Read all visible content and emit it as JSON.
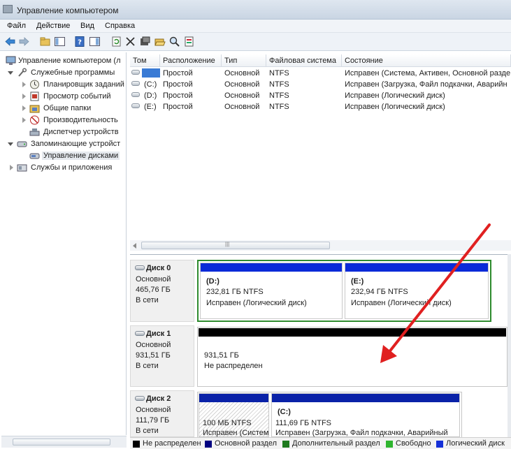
{
  "window": {
    "title": "Управление компьютером"
  },
  "menu": [
    "Файл",
    "Действие",
    "Вид",
    "Справка"
  ],
  "toolbar": {
    "icons": [
      "back-icon",
      "forward-icon",
      "up-folder-icon",
      "console-tree-icon",
      "help-icon",
      "show-hide-icon",
      "refresh-icon",
      "delete-icon",
      "properties-icon",
      "open-icon",
      "search-icon",
      "export-icon"
    ]
  },
  "tree": {
    "items": [
      {
        "label": "Управление компьютером (л",
        "icon": "computer-icon"
      },
      {
        "label": "Служебные программы",
        "icon": "tools-icon"
      },
      {
        "label": "Планировщик заданий",
        "icon": "clock-icon"
      },
      {
        "label": "Просмотр событий",
        "icon": "event-viewer-icon"
      },
      {
        "label": "Общие папки",
        "icon": "shared-folder-icon"
      },
      {
        "label": "Производительность",
        "icon": "performance-icon"
      },
      {
        "label": "Диспетчер устройств",
        "icon": "device-manager-icon"
      },
      {
        "label": "Запоминающие устройст",
        "icon": "storage-icon"
      },
      {
        "label": "Управление дисками",
        "icon": "disk-management-icon"
      },
      {
        "label": "Службы и приложения",
        "icon": "services-icon"
      }
    ]
  },
  "volumes": {
    "columns": [
      "Том",
      "Расположение",
      "Тип",
      "Файловая система",
      "Состояние"
    ],
    "rows": [
      {
        "volume": "",
        "layout": "Простой",
        "type": "Основной",
        "fs": "NTFS",
        "status": "Исправен (Система, Активен, Основной разде"
      },
      {
        "volume": "(C:)",
        "layout": "Простой",
        "type": "Основной",
        "fs": "NTFS",
        "status": "Исправен (Загрузка, Файл подкачки, Аварийн"
      },
      {
        "volume": "(D:)",
        "layout": "Простой",
        "type": "Основной",
        "fs": "NTFS",
        "status": "Исправен (Логический диск)"
      },
      {
        "volume": "(E:)",
        "layout": "Простой",
        "type": "Основной",
        "fs": "NTFS",
        "status": "Исправен (Логический диск)"
      }
    ]
  },
  "disks": [
    {
      "name": "Диск 0",
      "kind": "Основной",
      "size": "465,76 ГБ",
      "state": "В сети",
      "partitions": [
        {
          "title": "(D:)",
          "size": "232,81 ГБ NTFS",
          "status": "Исправен (Логический диск)"
        },
        {
          "title": "(E:)",
          "size": "232,94 ГБ NTFS",
          "status": "Исправен (Логический диск)"
        }
      ]
    },
    {
      "name": "Диск 1",
      "kind": "Основной",
      "size": "931,51 ГБ",
      "state": "В сети",
      "partitions": [
        {
          "title": "",
          "size": "931,51 ГБ",
          "status": "Не распределен"
        }
      ]
    },
    {
      "name": "Диск 2",
      "kind": "Основной",
      "size": "111,79 ГБ",
      "state": "В сети",
      "partitions": [
        {
          "title": "",
          "size": "100 МБ NTFS",
          "status": "Исправен (Систем"
        },
        {
          "title": "(C:)",
          "size": "111,69 ГБ NTFS",
          "status": "Исправен (Загрузка, Файл подкачки, Аварийный"
        }
      ]
    }
  ],
  "legend": [
    {
      "label": "Не распределен",
      "color": "#000000"
    },
    {
      "label": "Основной раздел",
      "color": "#000080"
    },
    {
      "label": "Дополнительный раздел",
      "color": "#1e7a1e"
    },
    {
      "label": "Свободно",
      "color": "#2fb52f"
    },
    {
      "label": "Логический диск",
      "color": "#1530d8"
    }
  ],
  "colors": {
    "primary_partition": "#0000cc",
    "unallocated": "#000000",
    "extended_border": "#2e8b2e",
    "annotation_arrow": "#e02020"
  }
}
